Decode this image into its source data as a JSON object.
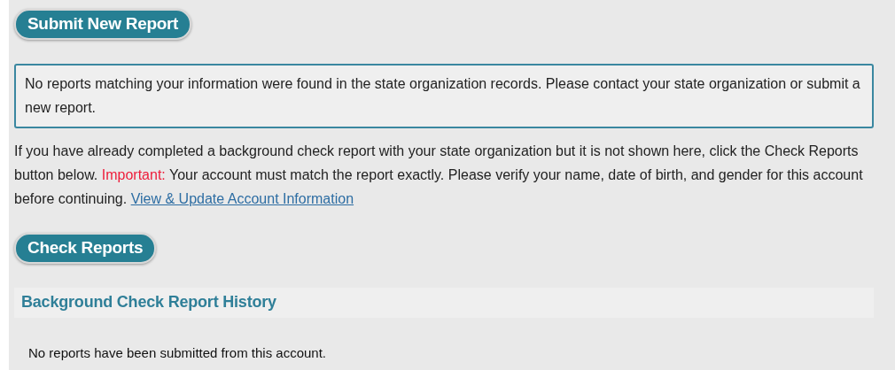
{
  "submit_button": {
    "label": "Submit New Report"
  },
  "alert": {
    "text": "No reports matching your information were found in the state organization records. Please contact your state organization or submit a new report."
  },
  "info": {
    "parts": [
      {
        "kind": "text",
        "text": "If you have already completed a background check report with your state organization but it is not shown here, click the Check Reports button below. "
      },
      {
        "kind": "important",
        "text": "Important:"
      },
      {
        "kind": "text",
        "text": " Your account must match the report exactly. Please verify your name, date of birth, and gender for this account before continuing. "
      },
      {
        "kind": "link",
        "text": "View & Update Account Information"
      }
    ]
  },
  "check_button": {
    "label": "Check Reports"
  },
  "history": {
    "title": "Background Check Report History",
    "empty_text": "No reports have been submitted from this account."
  }
}
